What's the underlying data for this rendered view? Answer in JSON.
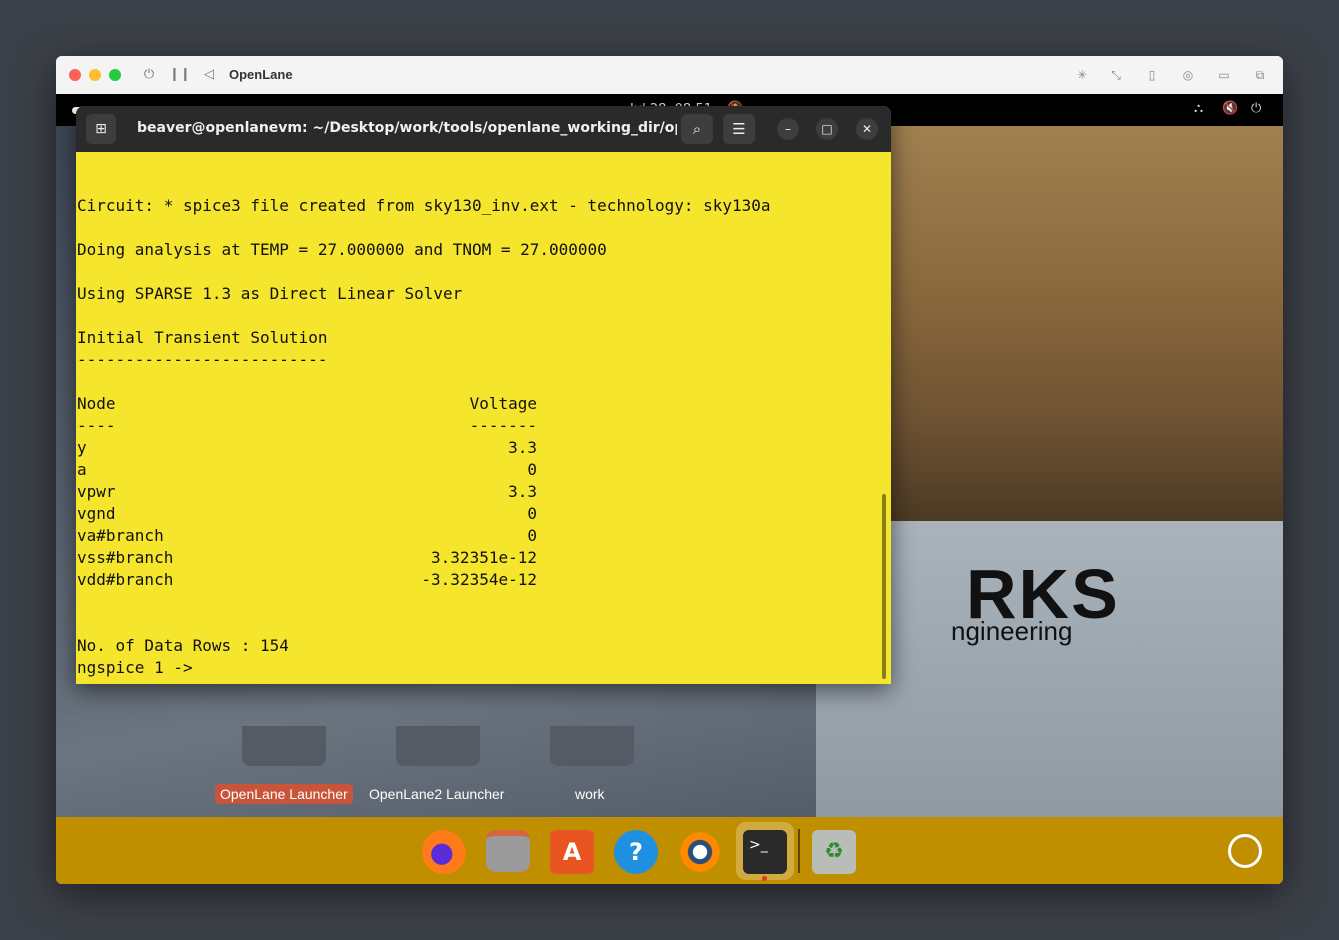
{
  "vm": {
    "title": "OpenLane",
    "controls": [
      "power-icon",
      "pause-icon",
      "back-icon"
    ],
    "right_icons": [
      "brightness-icon",
      "resize-icon",
      "usb-icon",
      "camera-icon",
      "folder-share-icon",
      "windows-icon"
    ]
  },
  "topbar": {
    "date": "Jul 28",
    "time": "08:51",
    "tray_icons": [
      "network-icon",
      "volume-muted-icon",
      "power-icon"
    ]
  },
  "terminal": {
    "title": "beaver@openlanevm: ~/Desktop/work/tools/openlane_working_dir/openl...",
    "lines": {
      "circuit": "Circuit: * spice3 file created from sky130_inv.ext - technology: sky130a",
      "analysis": "Doing analysis at TEMP = 27.000000 and TNOM = 27.000000",
      "solver": "Using SPARSE 1.3 as Direct Linear Solver",
      "initial": "Initial Transient Solution",
      "rule": "--------------------------",
      "rows": "No. of Data Rows : 154",
      "prompt": "ngspice 1 ->"
    },
    "table": {
      "col_node": "Node",
      "col_voltage": "Voltage",
      "sep_node": "----",
      "sep_voltage": "-------",
      "rows": [
        {
          "node": "y",
          "voltage": "3.3"
        },
        {
          "node": "a",
          "voltage": "0"
        },
        {
          "node": "vpwr",
          "voltage": "3.3"
        },
        {
          "node": "vgnd",
          "voltage": "0"
        },
        {
          "node": "va#branch",
          "voltage": "0"
        },
        {
          "node": "vss#branch",
          "voltage": "3.32351e-12"
        },
        {
          "node": "vdd#branch",
          "voltage": "-3.32354e-12"
        }
      ]
    }
  },
  "desktop": {
    "icons": [
      {
        "label": "OpenLane Launcher"
      },
      {
        "label": "OpenLane2 Launcher"
      },
      {
        "label": "work"
      }
    ],
    "wallpaper_text": "RKS",
    "wallpaper_sub": "ngineering"
  },
  "dock": {
    "apps": [
      "firefox-icon",
      "files-icon",
      "app-center-icon",
      "help-icon",
      "blender-icon",
      "terminal-icon",
      "trash-icon"
    ],
    "launcher": "show-apps-icon"
  },
  "colors": {
    "terminal_bg": "#f5e52c",
    "dock_bg": "#bf8f00",
    "selected_label": "#c8553a"
  }
}
